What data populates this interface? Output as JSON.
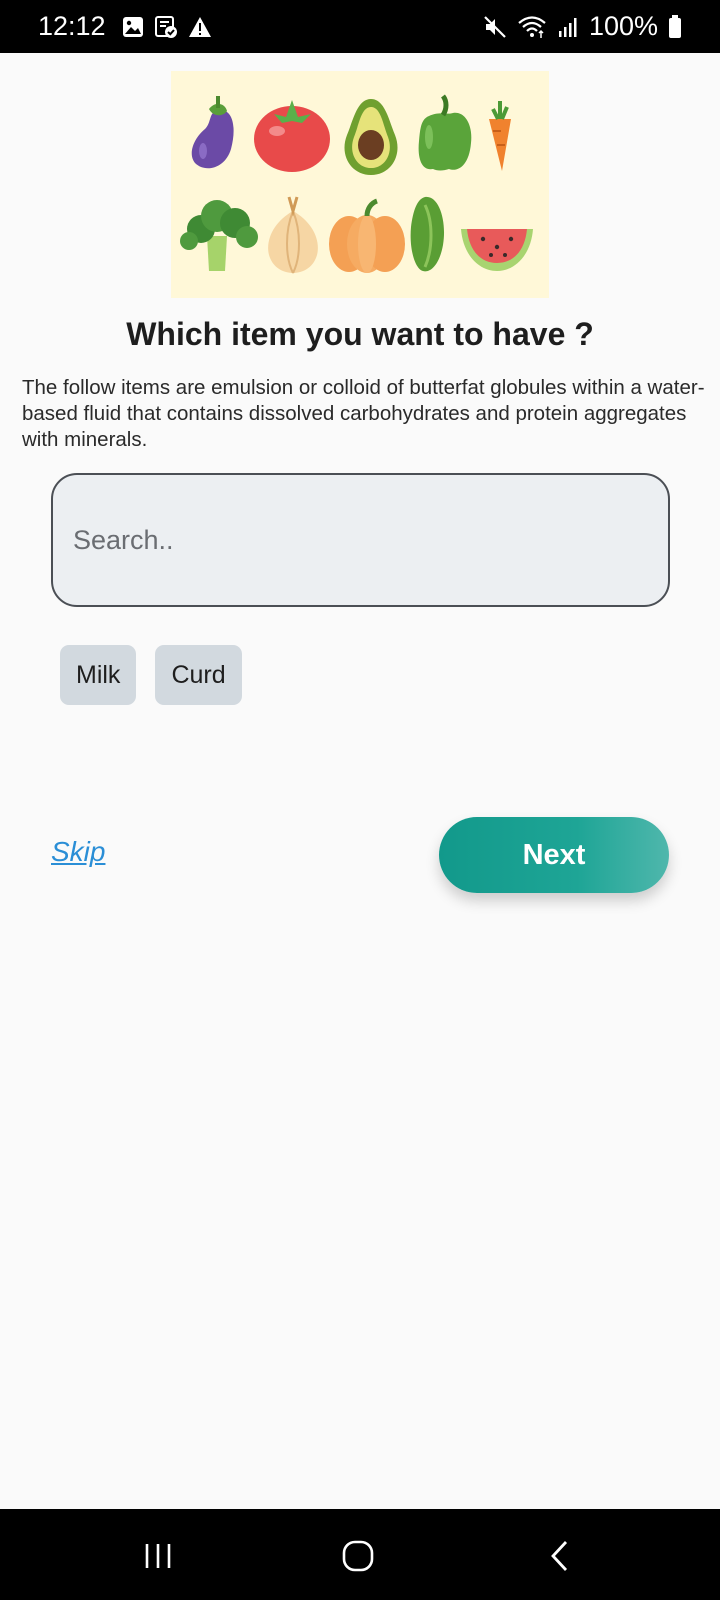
{
  "status_bar": {
    "time": "12:12",
    "battery": "100%",
    "left_icons": [
      "image-icon",
      "clipboard-check-icon",
      "warning-icon"
    ],
    "right_icons": [
      "mute-icon",
      "wifi-icon",
      "signal-icon",
      "battery-icon"
    ]
  },
  "banner": {
    "icon": "vegetables-illustration",
    "items": [
      "eggplant",
      "tomato",
      "avocado",
      "bell-pepper",
      "carrot",
      "broccoli",
      "onion",
      "pumpkin",
      "cucumber",
      "watermelon"
    ]
  },
  "question": {
    "title": "Which item you want to have ?",
    "description": "The follow items are emulsion or colloid of butterfat globules within a water-based fluid that contains dissolved carbohydrates and protein aggregates with minerals."
  },
  "search": {
    "placeholder": "Search..",
    "value": ""
  },
  "chips": [
    {
      "label": "Milk"
    },
    {
      "label": "Curd"
    }
  ],
  "actions": {
    "skip_label": "Skip",
    "next_label": "Next"
  },
  "nav_bar": {
    "icons": [
      "recents-icon",
      "home-icon",
      "back-icon"
    ]
  },
  "colors": {
    "accent": "#1a9e90",
    "link": "#2a8ed6",
    "chip": "#d2d9df",
    "banner_bg": "#fff8d8"
  }
}
